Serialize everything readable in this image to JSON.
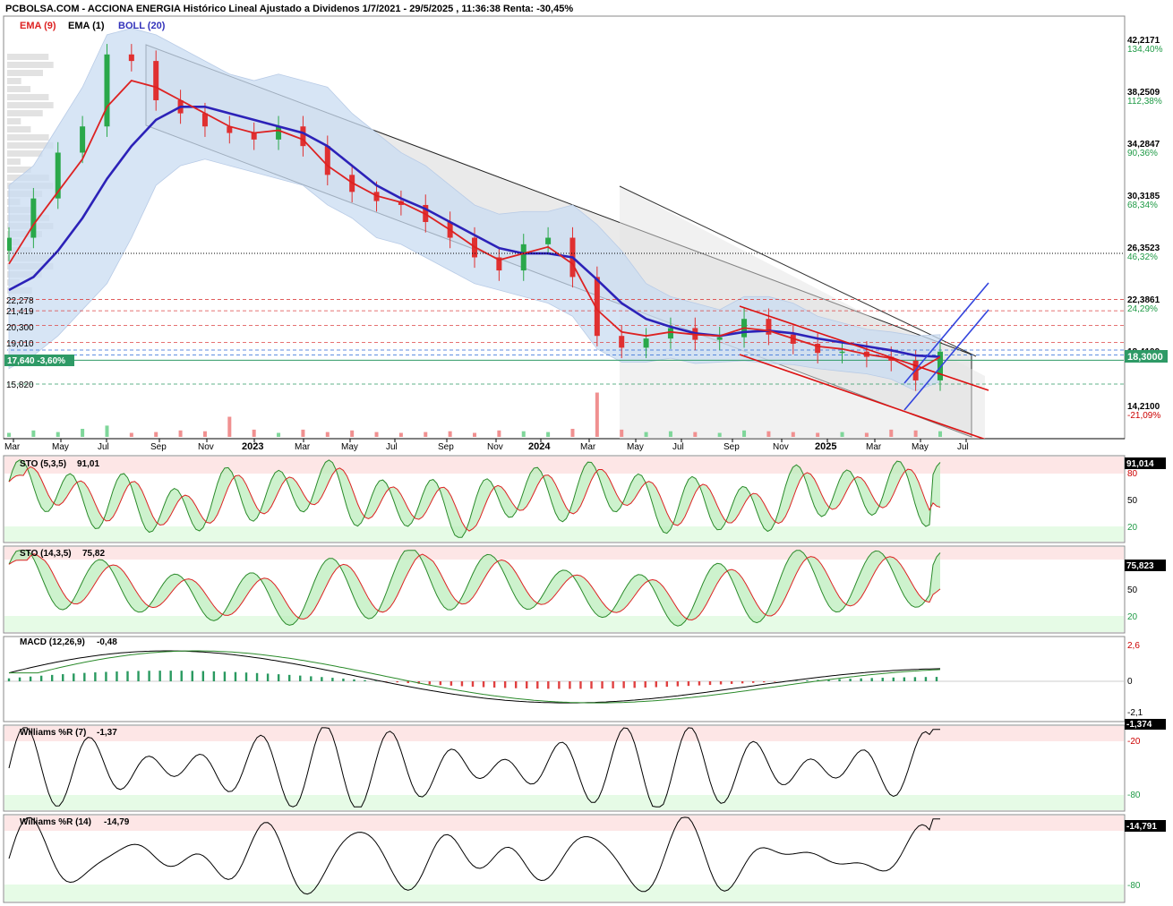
{
  "header": {
    "title": "PCBOLSA.COM - ACCIONA ENERGIA Histórico Lineal Ajustado a Dividenos 1/7/2021 - 29/5/2025 , 11:36:38 Renta: -30,45%",
    "legend": [
      {
        "label": "EMA (9)",
        "color": "#dd2222"
      },
      {
        "label": "EMA (1)",
        "color": "#000000"
      },
      {
        "label": "BOLL (20)",
        "color": "#3333bb"
      }
    ]
  },
  "colors": {
    "up": "#2aa84a",
    "down": "#e03030",
    "ema9": "#dd2222",
    "boll_mid": "#2c22b8",
    "boll_band": "#c9dcf2",
    "overbought_zone": "#fde6e6",
    "oversold_zone": "#e6fbe6",
    "channel": "#111111",
    "red_channel": "#dd1111",
    "blue_channel": "#3344dd",
    "price_tag": "#2e9a66",
    "ref_tag": "#f0a020"
  },
  "price_panel": {
    "y_labels": [
      {
        "value": "42,2171",
        "pct": "134,40%"
      },
      {
        "value": "38,2509",
        "pct": "112,38%"
      },
      {
        "value": "34,2847",
        "pct": "90,36%"
      },
      {
        "value": "30,3185",
        "pct": "68,34%"
      },
      {
        "value": "26,3523",
        "pct": "46,32%"
      },
      {
        "value": "22,3861",
        "pct": "24,29%"
      },
      {
        "value": "18,4199",
        "pct": ""
      },
      {
        "value": "14,2100",
        "pct": "-21,09%"
      }
    ],
    "current_price_tag": "18,3000",
    "reference_tag": "17,640  -3,60%",
    "levels": [
      "22,278",
      "21,419",
      "20,300",
      "19,010",
      "15,820"
    ],
    "x_labels": [
      "Mar",
      "May",
      "Jul",
      "Sep",
      "Nov",
      "2023",
      "Mar",
      "May",
      "Jul",
      "Sep",
      "Nov",
      "2024",
      "Mar",
      "May",
      "Jul",
      "Sep",
      "Nov",
      "2025",
      "Mar",
      "May",
      "Jul"
    ]
  },
  "sto1": {
    "name": "STO (5,3,5)",
    "value": "91,01",
    "tag": "91,014",
    "levels": [
      "80",
      "50",
      "20"
    ]
  },
  "sto2": {
    "name": "STO (14,3,5)",
    "value": "75,82",
    "tag": "75,823",
    "levels": [
      "50",
      "20"
    ]
  },
  "macd": {
    "name": "MACD (12,26,9)",
    "value": "-0,48",
    "levels": [
      "2,6",
      "0",
      "-2,1"
    ]
  },
  "wr1": {
    "name": "Williams %R (7)",
    "value": "-1,37",
    "tag": "-1,374",
    "levels": [
      "-20",
      "-80"
    ]
  },
  "wr2": {
    "name": "Williams %R (14)",
    "value": "-14,79",
    "tag": "-14,791",
    "levels": [
      "-80"
    ]
  },
  "chart_data": {
    "type": "line",
    "title": "PCBOLSA.COM - ACCIONA ENERGIA Histórico Lineal Ajustado a Dividenos 1/7/2021 - 29/5/2025 , 11:36:38 Renta: -30,45%",
    "ylim": [
      13.9,
      44.5
    ],
    "x": [
      "2022-03",
      "2022-04",
      "2022-05",
      "2022-06",
      "2022-07",
      "2022-08",
      "2022-09",
      "2022-10",
      "2022-11",
      "2022-12",
      "2023-01",
      "2023-02",
      "2023-03",
      "2023-04",
      "2023-05",
      "2023-06",
      "2023-07",
      "2023-08",
      "2023-09",
      "2023-10",
      "2023-11",
      "2023-12",
      "2024-01",
      "2024-02",
      "2024-03",
      "2024-04",
      "2024-05",
      "2024-06",
      "2024-07",
      "2024-08",
      "2024-09",
      "2024-10",
      "2024-11",
      "2024-12",
      "2025-01",
      "2025-02",
      "2025-03",
      "2025-04",
      "2025-05"
    ],
    "series": [
      {
        "name": "EMA (1)",
        "values": [
          27.0,
          30.0,
          33.5,
          35.5,
          41.0,
          40.5,
          37.5,
          36.5,
          35.5,
          35.0,
          34.5,
          35.5,
          34.0,
          31.8,
          30.5,
          29.8,
          29.5,
          28.2,
          27.0,
          25.5,
          24.5,
          26.5,
          27.0,
          24.0,
          19.5,
          18.6,
          19.3,
          20.1,
          19.2,
          19.4,
          20.8,
          19.6,
          18.9,
          18.2,
          18.3,
          17.9,
          17.6,
          16.1,
          18.3
        ]
      },
      {
        "name": "EMA (9)",
        "values": [
          25.0,
          28.0,
          30.5,
          33.0,
          37.0,
          39.0,
          38.5,
          37.5,
          36.5,
          35.5,
          35.0,
          35.2,
          34.5,
          32.5,
          31.2,
          30.2,
          29.7,
          28.8,
          27.6,
          26.3,
          25.3,
          25.8,
          26.3,
          25.0,
          21.5,
          19.8,
          19.5,
          19.8,
          19.6,
          19.5,
          20.1,
          19.9,
          19.3,
          18.7,
          18.5,
          18.1,
          17.8,
          16.8,
          17.9
        ]
      },
      {
        "name": "BOLL (20)",
        "values": [
          23.0,
          24.0,
          26.0,
          28.5,
          31.5,
          34.0,
          36.0,
          37.0,
          37.0,
          36.5,
          36.0,
          35.5,
          35.0,
          34.0,
          32.5,
          31.0,
          30.0,
          29.2,
          28.2,
          27.2,
          26.2,
          25.8,
          25.8,
          25.5,
          23.8,
          22.0,
          20.8,
          20.2,
          19.7,
          19.5,
          19.8,
          19.9,
          19.7,
          19.3,
          19.0,
          18.7,
          18.4,
          18.0,
          17.9
        ]
      }
    ],
    "bollinger": {
      "upper": [
        31.0,
        32.5,
        35.5,
        38.5,
        42.5,
        43.0,
        42.5,
        41.5,
        40.5,
        39.5,
        39.0,
        39.5,
        39.0,
        38.5,
        36.5,
        35.0,
        33.5,
        32.5,
        31.0,
        29.5,
        28.8,
        29.0,
        29.0,
        29.5,
        28.0,
        26.0,
        23.5,
        22.5,
        22.0,
        21.5,
        22.5,
        22.5,
        22.0,
        21.0,
        20.5,
        20.0,
        19.8,
        19.5,
        19.6
      ],
      "lower": [
        17.0,
        18.0,
        19.5,
        21.5,
        23.5,
        27.0,
        31.0,
        32.5,
        33.0,
        32.5,
        32.0,
        31.5,
        31.0,
        29.5,
        28.5,
        27.0,
        26.5,
        25.5,
        24.5,
        23.5,
        23.0,
        22.5,
        22.0,
        21.0,
        18.5,
        17.5,
        17.5,
        17.8,
        17.4,
        17.5,
        17.6,
        17.4,
        17.3,
        17.0,
        16.8,
        16.6,
        16.2,
        15.3,
        16.0
      ]
    },
    "volume_relative": [
      0.05,
      0.08,
      0.06,
      0.1,
      0.14,
      0.05,
      0.06,
      0.08,
      0.07,
      0.25,
      0.09,
      0.05,
      0.09,
      0.06,
      0.08,
      0.06,
      0.05,
      0.06,
      0.07,
      0.05,
      0.08,
      0.07,
      0.06,
      0.1,
      0.55,
      0.09,
      0.06,
      0.07,
      0.06,
      0.05,
      0.08,
      0.07,
      0.06,
      0.05,
      0.06,
      0.05,
      0.09,
      0.08,
      0.07
    ]
  }
}
